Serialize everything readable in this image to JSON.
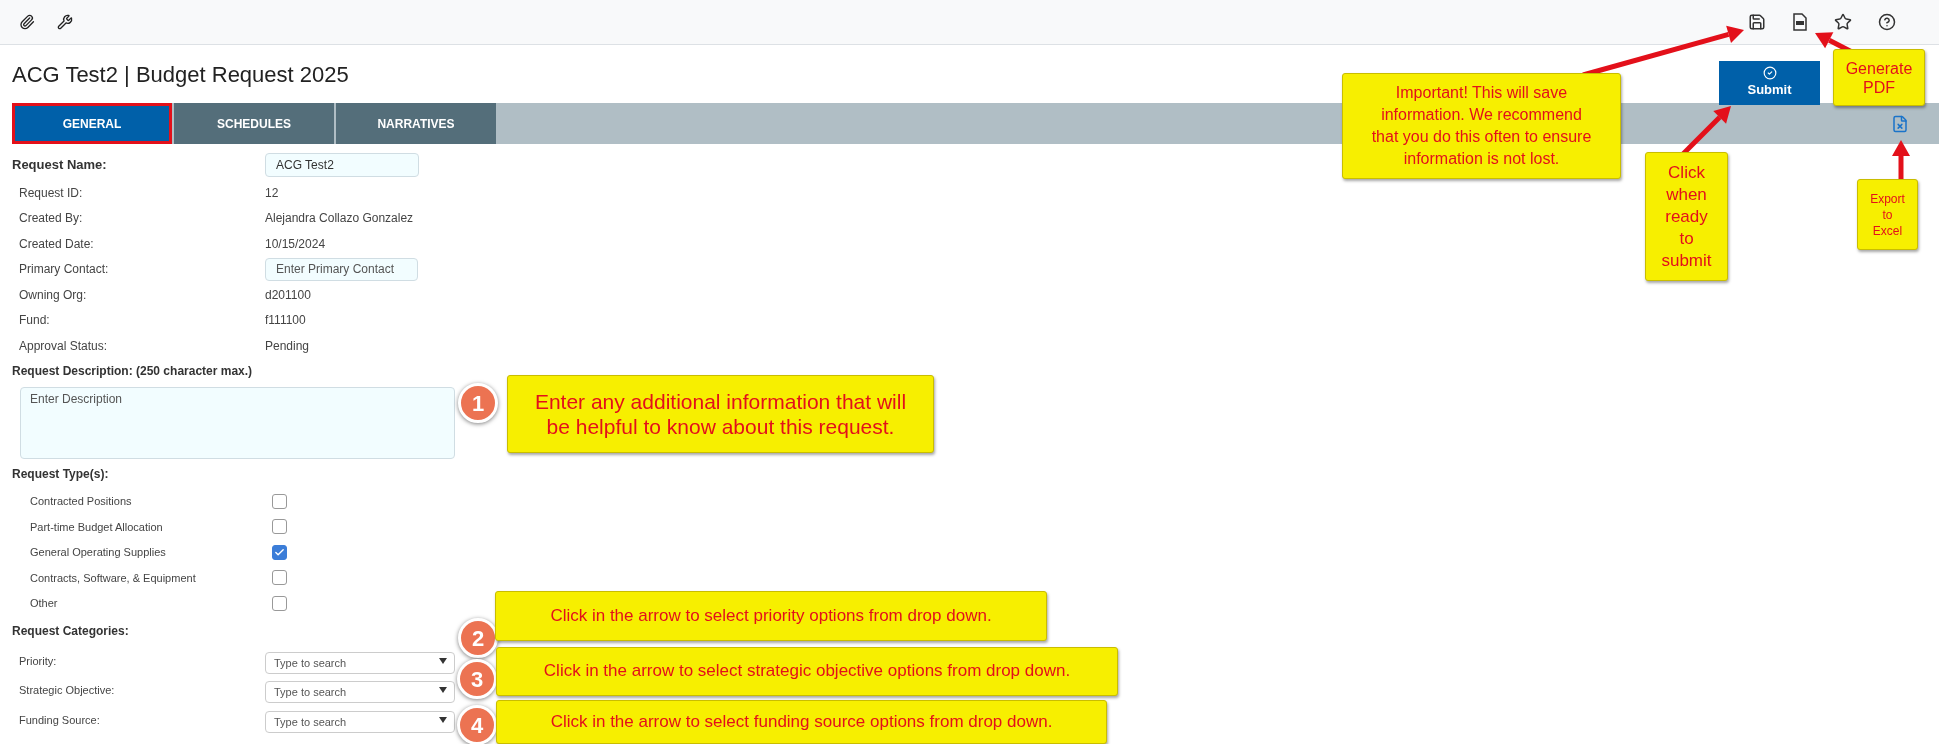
{
  "title": "ACG Test2 | Budget Request 2025",
  "tabs": [
    {
      "label": "GENERAL",
      "selected": true,
      "highlighted": true
    },
    {
      "label": "SCHEDULES",
      "selected": false,
      "highlighted": false
    },
    {
      "label": "NARRATIVES",
      "selected": false,
      "highlighted": false
    }
  ],
  "submit_button": {
    "label": "Submit"
  },
  "request_name": {
    "label": "Request Name:",
    "value": "ACG Test2"
  },
  "details": [
    {
      "kind": "text",
      "label": "Request ID:",
      "value": "12"
    },
    {
      "kind": "text",
      "label": "Created By:",
      "value": "Alejandra Collazo Gonzalez"
    },
    {
      "kind": "text",
      "label": "Created Date:",
      "value": "10/15/2024"
    },
    {
      "kind": "input",
      "label": "Primary Contact:",
      "placeholder": "Enter Primary Contact"
    },
    {
      "kind": "text",
      "label": "Owning Org:",
      "value": "d201100"
    },
    {
      "kind": "text",
      "label": "Fund:",
      "value": "f111100"
    },
    {
      "kind": "text",
      "label": "Approval Status:",
      "value": "Pending"
    }
  ],
  "description": {
    "label": "Request Description: (250 character max.)",
    "placeholder": "Enter Description"
  },
  "request_types": {
    "label": "Request Type(s):",
    "items": [
      {
        "label": "Contracted Positions",
        "checked": false
      },
      {
        "label": "Part-time Budget Allocation",
        "checked": false
      },
      {
        "label": "General Operating Supplies",
        "checked": true
      },
      {
        "label": "Contracts, Software, & Equipment",
        "checked": false
      },
      {
        "label": "Other",
        "checked": false
      }
    ]
  },
  "request_categories": {
    "label": "Request Categories:",
    "items": [
      {
        "label": "Priority:",
        "placeholder": "Type to search"
      },
      {
        "label": "Strategic Objective:",
        "placeholder": "Type to search"
      },
      {
        "label": "Funding Source:",
        "placeholder": "Type to search"
      }
    ]
  },
  "numbered_callouts": [
    {
      "number": "1",
      "text": "Enter any additional information that will be helpful to know about this request."
    },
    {
      "number": "2",
      "text": "Click in the arrow to select priority options from drop down."
    },
    {
      "number": "3",
      "text": "Click in the arrow to select strategic objective options from drop down."
    },
    {
      "number": "4",
      "text": "Click in the arrow to select funding source options from drop down."
    }
  ],
  "notes": [
    {
      "text": "Important! This will save information. We recommend that you do this often to ensure information is not lost."
    },
    {
      "text": "Click when ready to submit"
    },
    {
      "text": "Generate PDF"
    },
    {
      "text": "Export to Excel"
    }
  ]
}
